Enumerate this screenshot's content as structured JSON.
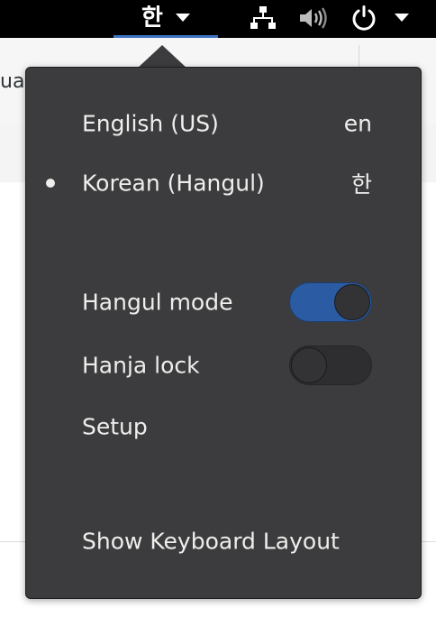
{
  "topbar": {
    "input_method_label": "한",
    "icons": [
      "network-wired-icon",
      "volume-icon",
      "power-icon",
      "system-menu-arrow-icon"
    ]
  },
  "background": {
    "partial_text": "ua"
  },
  "menu": {
    "layouts": [
      {
        "label": "English (US)",
        "code": "en",
        "active": false
      },
      {
        "label": "Korean (Hangul)",
        "code": "한",
        "active": true
      }
    ],
    "hangul_mode": {
      "label": "Hangul mode",
      "enabled": true
    },
    "hanja_lock": {
      "label": "Hanja lock",
      "enabled": false
    },
    "setup_label": "Setup",
    "show_layout_label": "Show Keyboard Layout"
  },
  "colors": {
    "accent": "#3d74c4",
    "switch_on": "#2b5ba2",
    "popover_bg": "#3c3c3e"
  }
}
